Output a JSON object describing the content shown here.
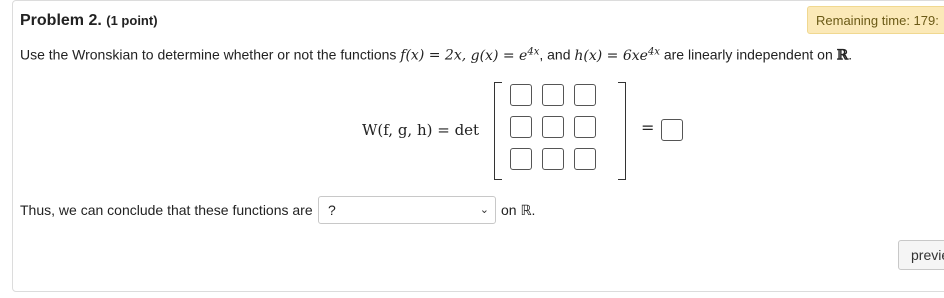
{
  "problem": {
    "title": "Problem 2.",
    "points": "(1 point)"
  },
  "timer": {
    "label": "Remaining time: 179:"
  },
  "statement": {
    "intro": "Use the Wronskian to determine whether or not the functions ",
    "f": "f(x) = 2x,",
    "g_prefix": " g(x) = e",
    "g_exp": "4x",
    "and_text": ", and ",
    "h_prefix": "h(x) = 6xe",
    "h_exp": "4x",
    "tail": " are linearly independent on ",
    "reals": "ℝ",
    "period": "."
  },
  "wronskian": {
    "label": "W(f, g, h) = det",
    "equals": "="
  },
  "conclusion": {
    "text": "Thus, we can conclude that these functions are",
    "select_value": "?",
    "suffix": "on ℝ."
  },
  "buttons": {
    "preview": "previe"
  }
}
